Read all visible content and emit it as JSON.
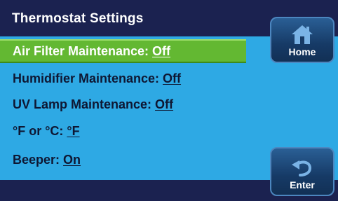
{
  "title": "Thermostat Settings",
  "items": [
    {
      "label": "Air Filter Maintenance: ",
      "value": "Off",
      "selected": true
    },
    {
      "label": "Humidifier Maintenance: ",
      "value": "Off",
      "selected": false
    },
    {
      "label": "UV Lamp Maintenance: ",
      "value": "Off",
      "selected": false
    },
    {
      "label": "°F or °C: ",
      "value": "°F",
      "selected": false
    },
    {
      "label": "Beeper: ",
      "value": "On",
      "selected": false
    }
  ],
  "buttons": {
    "home": {
      "label": "Home",
      "icon": "home-icon"
    },
    "enter": {
      "label": "Enter",
      "icon": "back-arrow-icon"
    }
  },
  "colors": {
    "background_dark": "#1b2250",
    "menu_blue": "#2ea9e4",
    "selected_green": "#63b832",
    "button_blue": "#163a66"
  }
}
